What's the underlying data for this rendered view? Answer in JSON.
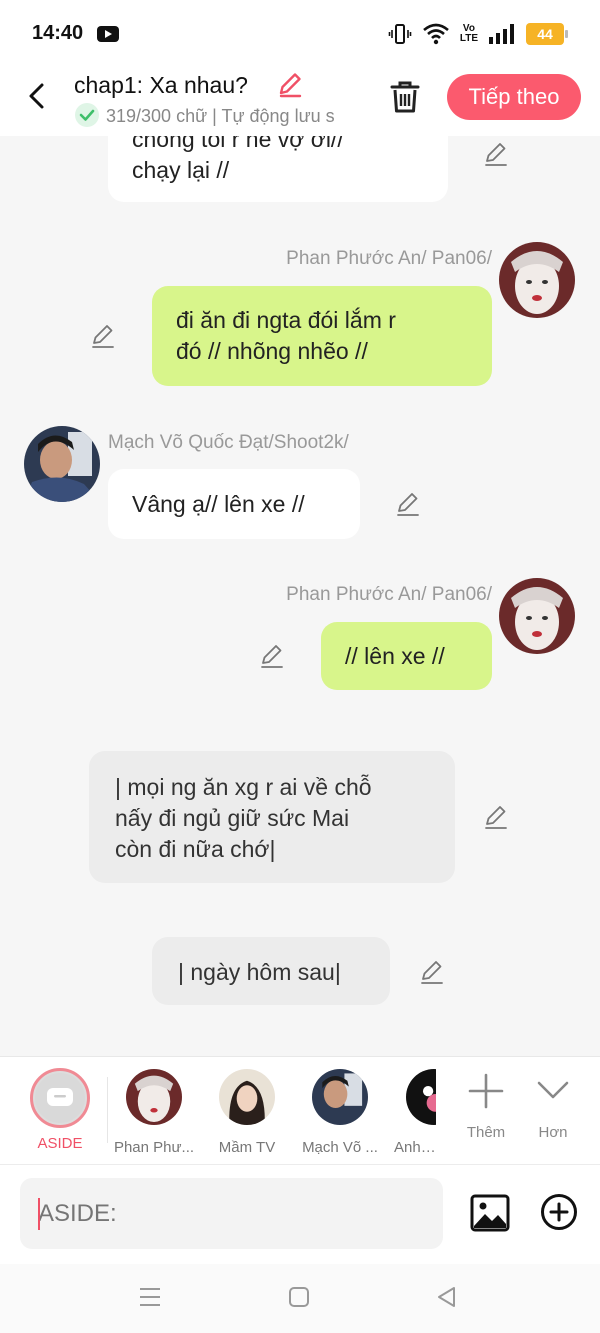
{
  "status": {
    "time": "14:40",
    "network": "Vo\nLTE",
    "battery": "44"
  },
  "header": {
    "title": "chap1: Xa nhau?",
    "subtitle": "319/300 chữ | Tự động lưu s",
    "next_label": "Tiếp theo"
  },
  "messages": [
    {
      "kind": "white",
      "text": "chồng tôi r hẻ vợ ơi//\nchạy lại //"
    },
    {
      "kind": "green",
      "speaker": "Phan Phước An/ Pan06/",
      "text": "đi ăn đi ngta đói lắm r\nđó // nhõng nhẽo //"
    },
    {
      "kind": "white",
      "speaker": "Mạch Võ Quốc Đạt/Shoot2k/",
      "text": "Vâng ạ// lên xe //"
    },
    {
      "kind": "green",
      "speaker": "Phan Phước An/ Pan06/",
      "text": "// lên xe //"
    },
    {
      "kind": "aside",
      "text": "| mọi ng ăn xg r ai về chỗ\nnấy đi ngủ giữ sức Mai\ncòn đi nữa chớ|"
    },
    {
      "kind": "aside",
      "text": "| ngày hôm sau|"
    }
  ],
  "characters": {
    "aside": "ASIDE",
    "list": [
      "Phan Phư...",
      "Mầm TV",
      "Mạch Võ ...",
      "Anh G"
    ],
    "more_label": "Thêm",
    "expand_label": "Hơn"
  },
  "composer": {
    "placeholder": "ASIDE:"
  },
  "colors": {
    "accent": "#fb5a6e",
    "green_bubble": "#d8f58b",
    "aside_bubble": "#ececec"
  }
}
